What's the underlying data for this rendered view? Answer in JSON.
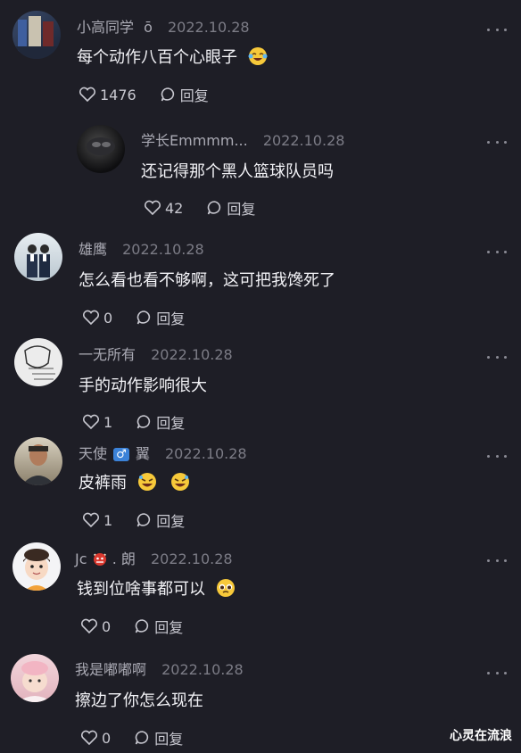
{
  "comments": [
    {
      "name": "小高同学",
      "badge": "ō",
      "date": "2022.10.28",
      "text": "每个动作八百个心眼子",
      "emoji": "laughing-crying-emoji",
      "likes": "1476",
      "reply": "回复"
    },
    {
      "name": "学长Emmmm...",
      "date": "2022.10.28",
      "text": "还记得那个黑人篮球队员吗",
      "likes": "42",
      "reply": "回复"
    },
    {
      "name": "雄鹰",
      "date": "2022.10.28",
      "text": "怎么看也看不够啊，这可把我馋死了",
      "likes": "0",
      "reply": "回复"
    },
    {
      "name": "一无所有",
      "date": "2022.10.28",
      "text": "手的动作影响很大",
      "likes": "1",
      "reply": "回复"
    },
    {
      "name_a": "天使",
      "name_b": "翼",
      "badge": "male-sign-badge",
      "date": "2022.10.28",
      "text": "皮裤雨",
      "emoji": "rolling-laughing-emoji",
      "likes": "1",
      "reply": "回复"
    },
    {
      "name_a": "Jc",
      "name_b": ". 朗",
      "badge": "ogre-emoji",
      "date": "2022.10.28",
      "text": "钱到位啥事都可以",
      "emoji": "pleading-emoji",
      "likes": "0",
      "reply": "回复"
    },
    {
      "name": "我是嘟嘟啊",
      "date": "2022.10.28",
      "text": "擦边了你怎么现在",
      "likes": "0",
      "reply": "回复"
    }
  ],
  "watermark": "心灵在流浪",
  "colors": {
    "background": "#1e1e26",
    "name": "#a9a9b3",
    "date": "#7c7c86",
    "text": "#f2f2f6"
  }
}
